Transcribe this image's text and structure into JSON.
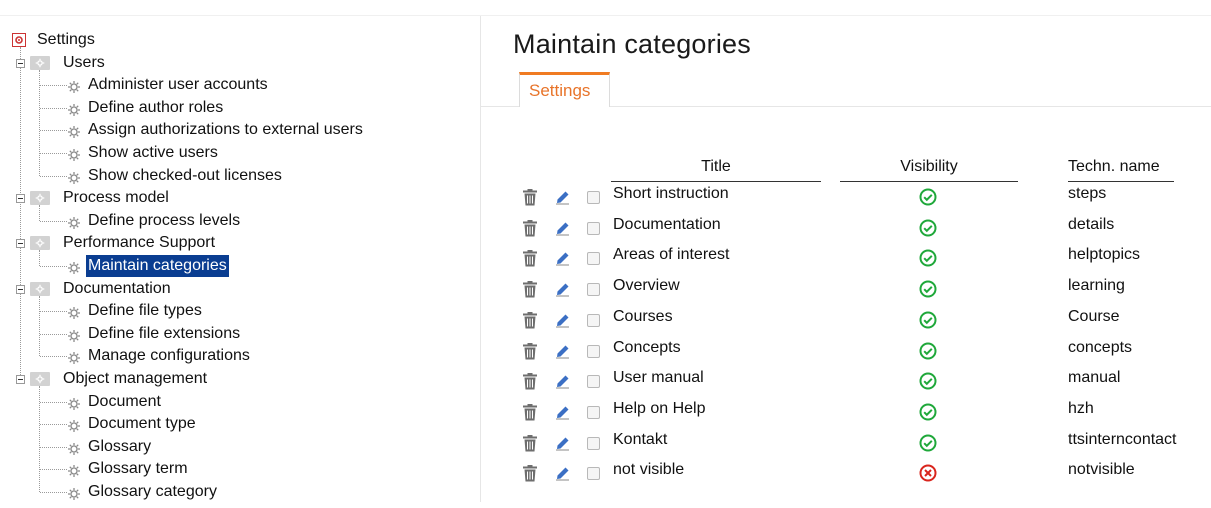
{
  "tree": {
    "root_label": "Settings",
    "nodes": [
      {
        "label": "Users",
        "level": 1,
        "kind": "folder"
      },
      {
        "label": "Administer user accounts",
        "level": 2,
        "kind": "item"
      },
      {
        "label": "Define author roles",
        "level": 2,
        "kind": "item"
      },
      {
        "label": "Assign authorizations to external users",
        "level": 2,
        "kind": "item"
      },
      {
        "label": "Show active users",
        "level": 2,
        "kind": "item"
      },
      {
        "label": "Show checked-out licenses",
        "level": 2,
        "kind": "item"
      },
      {
        "label": "Process model",
        "level": 1,
        "kind": "folder"
      },
      {
        "label": "Define process levels",
        "level": 2,
        "kind": "item"
      },
      {
        "label": "Performance Support",
        "level": 1,
        "kind": "folder"
      },
      {
        "label": "Maintain categories",
        "level": 2,
        "kind": "item",
        "selected": true
      },
      {
        "label": "Documentation",
        "level": 1,
        "kind": "folder"
      },
      {
        "label": "Define file types",
        "level": 2,
        "kind": "item"
      },
      {
        "label": "Define file extensions",
        "level": 2,
        "kind": "item"
      },
      {
        "label": "Manage configurations",
        "level": 2,
        "kind": "item"
      },
      {
        "label": "Object management",
        "level": 1,
        "kind": "folder"
      },
      {
        "label": "Document",
        "level": 2,
        "kind": "item"
      },
      {
        "label": "Document type",
        "level": 2,
        "kind": "item"
      },
      {
        "label": "Glossary",
        "level": 2,
        "kind": "item"
      },
      {
        "label": "Glossary term",
        "level": 2,
        "kind": "item"
      },
      {
        "label": "Glossary category",
        "level": 2,
        "kind": "item"
      }
    ]
  },
  "main": {
    "title": "Maintain categories",
    "tab_label": "Settings",
    "columns": {
      "title": "Title",
      "visibility": "Visibility",
      "techn_name": "Techn. name"
    },
    "rows": [
      {
        "title": "Short instruction",
        "visible": true,
        "techn": "steps"
      },
      {
        "title": "Documentation",
        "visible": true,
        "techn": "details"
      },
      {
        "title": "Areas of interest",
        "visible": true,
        "techn": "helptopics"
      },
      {
        "title": "Overview",
        "visible": true,
        "techn": "learning"
      },
      {
        "title": "Courses",
        "visible": true,
        "techn": "Course"
      },
      {
        "title": "Concepts",
        "visible": true,
        "techn": "concepts"
      },
      {
        "title": "User manual",
        "visible": true,
        "techn": "manual"
      },
      {
        "title": "Help on Help",
        "visible": true,
        "techn": "hzh"
      },
      {
        "title": "Kontakt",
        "visible": true,
        "techn": "ttsinterncontact"
      },
      {
        "title": "not visible",
        "visible": false,
        "techn": "notvisible"
      }
    ]
  },
  "icons": {
    "delete": "trash-icon",
    "edit": "pencil-icon",
    "visible": "check-circle-icon",
    "not_visible": "x-circle-icon",
    "tree_item": "gear-icon",
    "tree_folder": "folder-gear-icon",
    "root": "settings-root-icon"
  },
  "colors": {
    "accent": "#f07b22",
    "selection": "#0a3d91",
    "visible_green": "#1fa83a",
    "not_visible_red": "#d9251d",
    "edit_blue": "#3b6fc4",
    "trash_gray": "#6e6e6e"
  }
}
